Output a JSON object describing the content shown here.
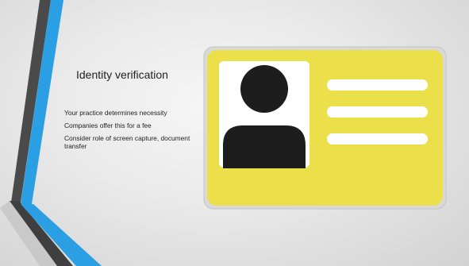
{
  "slide": {
    "title": "Identity verification",
    "bullets": [
      "Your practice determines necessity",
      "Companies offer this for a fee",
      "Consider role of screen capture, document transfer"
    ]
  },
  "colors": {
    "card_yellow": "#ebe04a",
    "card_frame": "#d9d9d9",
    "photo_white": "#ffffff",
    "silhouette": "#1d1d1d",
    "accent_blue": "#2a9fe3",
    "accent_dark": "#4a4a4a"
  },
  "icons": {
    "id_card": "id-card-icon",
    "person": "person-silhouette-icon"
  }
}
